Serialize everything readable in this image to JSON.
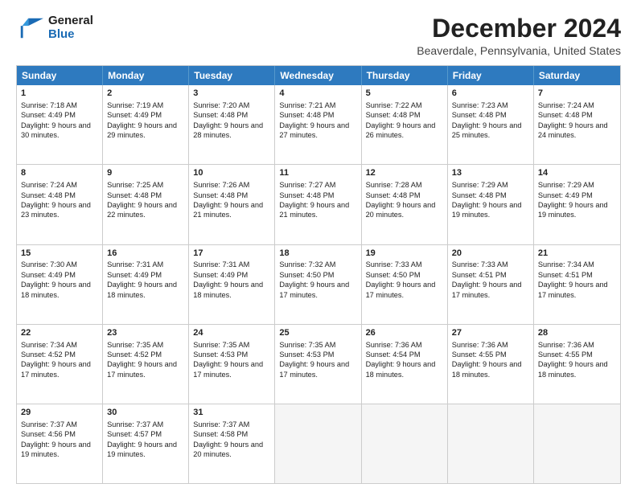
{
  "header": {
    "logo_line1": "General",
    "logo_line2": "Blue",
    "title": "December 2024",
    "subtitle": "Beaverdale, Pennsylvania, United States"
  },
  "calendar": {
    "days": [
      "Sunday",
      "Monday",
      "Tuesday",
      "Wednesday",
      "Thursday",
      "Friday",
      "Saturday"
    ],
    "rows": [
      [
        {
          "day": "1",
          "sunrise": "Sunrise: 7:18 AM",
          "sunset": "Sunset: 4:49 PM",
          "daylight": "Daylight: 9 hours and 30 minutes."
        },
        {
          "day": "2",
          "sunrise": "Sunrise: 7:19 AM",
          "sunset": "Sunset: 4:49 PM",
          "daylight": "Daylight: 9 hours and 29 minutes."
        },
        {
          "day": "3",
          "sunrise": "Sunrise: 7:20 AM",
          "sunset": "Sunset: 4:48 PM",
          "daylight": "Daylight: 9 hours and 28 minutes."
        },
        {
          "day": "4",
          "sunrise": "Sunrise: 7:21 AM",
          "sunset": "Sunset: 4:48 PM",
          "daylight": "Daylight: 9 hours and 27 minutes."
        },
        {
          "day": "5",
          "sunrise": "Sunrise: 7:22 AM",
          "sunset": "Sunset: 4:48 PM",
          "daylight": "Daylight: 9 hours and 26 minutes."
        },
        {
          "day": "6",
          "sunrise": "Sunrise: 7:23 AM",
          "sunset": "Sunset: 4:48 PM",
          "daylight": "Daylight: 9 hours and 25 minutes."
        },
        {
          "day": "7",
          "sunrise": "Sunrise: 7:24 AM",
          "sunset": "Sunset: 4:48 PM",
          "daylight": "Daylight: 9 hours and 24 minutes."
        }
      ],
      [
        {
          "day": "8",
          "sunrise": "Sunrise: 7:24 AM",
          "sunset": "Sunset: 4:48 PM",
          "daylight": "Daylight: 9 hours and 23 minutes."
        },
        {
          "day": "9",
          "sunrise": "Sunrise: 7:25 AM",
          "sunset": "Sunset: 4:48 PM",
          "daylight": "Daylight: 9 hours and 22 minutes."
        },
        {
          "day": "10",
          "sunrise": "Sunrise: 7:26 AM",
          "sunset": "Sunset: 4:48 PM",
          "daylight": "Daylight: 9 hours and 21 minutes."
        },
        {
          "day": "11",
          "sunrise": "Sunrise: 7:27 AM",
          "sunset": "Sunset: 4:48 PM",
          "daylight": "Daylight: 9 hours and 21 minutes."
        },
        {
          "day": "12",
          "sunrise": "Sunrise: 7:28 AM",
          "sunset": "Sunset: 4:48 PM",
          "daylight": "Daylight: 9 hours and 20 minutes."
        },
        {
          "day": "13",
          "sunrise": "Sunrise: 7:29 AM",
          "sunset": "Sunset: 4:48 PM",
          "daylight": "Daylight: 9 hours and 19 minutes."
        },
        {
          "day": "14",
          "sunrise": "Sunrise: 7:29 AM",
          "sunset": "Sunset: 4:49 PM",
          "daylight": "Daylight: 9 hours and 19 minutes."
        }
      ],
      [
        {
          "day": "15",
          "sunrise": "Sunrise: 7:30 AM",
          "sunset": "Sunset: 4:49 PM",
          "daylight": "Daylight: 9 hours and 18 minutes."
        },
        {
          "day": "16",
          "sunrise": "Sunrise: 7:31 AM",
          "sunset": "Sunset: 4:49 PM",
          "daylight": "Daylight: 9 hours and 18 minutes."
        },
        {
          "day": "17",
          "sunrise": "Sunrise: 7:31 AM",
          "sunset": "Sunset: 4:49 PM",
          "daylight": "Daylight: 9 hours and 18 minutes."
        },
        {
          "day": "18",
          "sunrise": "Sunrise: 7:32 AM",
          "sunset": "Sunset: 4:50 PM",
          "daylight": "Daylight: 9 hours and 17 minutes."
        },
        {
          "day": "19",
          "sunrise": "Sunrise: 7:33 AM",
          "sunset": "Sunset: 4:50 PM",
          "daylight": "Daylight: 9 hours and 17 minutes."
        },
        {
          "day": "20",
          "sunrise": "Sunrise: 7:33 AM",
          "sunset": "Sunset: 4:51 PM",
          "daylight": "Daylight: 9 hours and 17 minutes."
        },
        {
          "day": "21",
          "sunrise": "Sunrise: 7:34 AM",
          "sunset": "Sunset: 4:51 PM",
          "daylight": "Daylight: 9 hours and 17 minutes."
        }
      ],
      [
        {
          "day": "22",
          "sunrise": "Sunrise: 7:34 AM",
          "sunset": "Sunset: 4:52 PM",
          "daylight": "Daylight: 9 hours and 17 minutes."
        },
        {
          "day": "23",
          "sunrise": "Sunrise: 7:35 AM",
          "sunset": "Sunset: 4:52 PM",
          "daylight": "Daylight: 9 hours and 17 minutes."
        },
        {
          "day": "24",
          "sunrise": "Sunrise: 7:35 AM",
          "sunset": "Sunset: 4:53 PM",
          "daylight": "Daylight: 9 hours and 17 minutes."
        },
        {
          "day": "25",
          "sunrise": "Sunrise: 7:35 AM",
          "sunset": "Sunset: 4:53 PM",
          "daylight": "Daylight: 9 hours and 17 minutes."
        },
        {
          "day": "26",
          "sunrise": "Sunrise: 7:36 AM",
          "sunset": "Sunset: 4:54 PM",
          "daylight": "Daylight: 9 hours and 18 minutes."
        },
        {
          "day": "27",
          "sunrise": "Sunrise: 7:36 AM",
          "sunset": "Sunset: 4:55 PM",
          "daylight": "Daylight: 9 hours and 18 minutes."
        },
        {
          "day": "28",
          "sunrise": "Sunrise: 7:36 AM",
          "sunset": "Sunset: 4:55 PM",
          "daylight": "Daylight: 9 hours and 18 minutes."
        }
      ],
      [
        {
          "day": "29",
          "sunrise": "Sunrise: 7:37 AM",
          "sunset": "Sunset: 4:56 PM",
          "daylight": "Daylight: 9 hours and 19 minutes."
        },
        {
          "day": "30",
          "sunrise": "Sunrise: 7:37 AM",
          "sunset": "Sunset: 4:57 PM",
          "daylight": "Daylight: 9 hours and 19 minutes."
        },
        {
          "day": "31",
          "sunrise": "Sunrise: 7:37 AM",
          "sunset": "Sunset: 4:58 PM",
          "daylight": "Daylight: 9 hours and 20 minutes."
        },
        null,
        null,
        null,
        null
      ]
    ]
  }
}
